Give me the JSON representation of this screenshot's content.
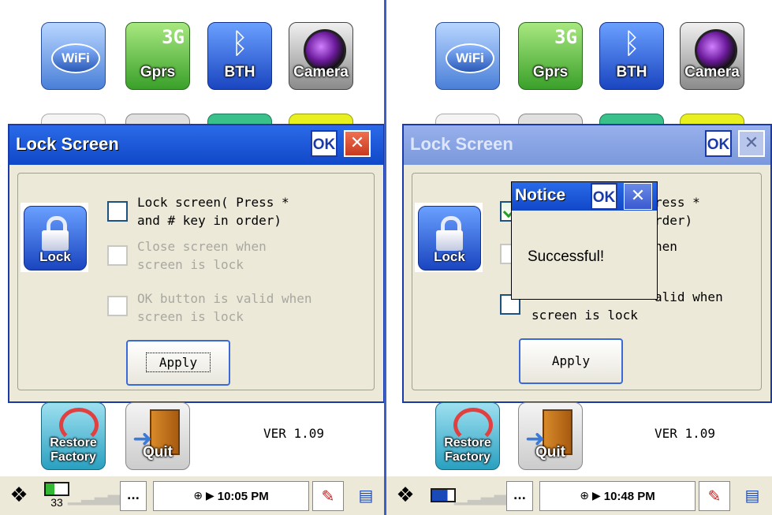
{
  "apps": {
    "wifi": "WiFi",
    "gprs": "Gprs",
    "gprs_badge": "3G",
    "bth": "BTH",
    "camera": "Camera",
    "restore": "Restore Factory",
    "quit": "Quit"
  },
  "lock_dialog": {
    "title": "Lock Screen",
    "ok": "OK",
    "close": "✕",
    "lock_label": "Lock",
    "options": [
      {
        "text": "Lock screen( Press *\nand # key in order)",
        "enabled": true
      },
      {
        "text": "Close screen when\nscreen is lock",
        "enabled": false
      },
      {
        "text": "OK button is valid when\nscreen is lock",
        "enabled": false
      }
    ],
    "apply": "Apply"
  },
  "right_lock_dialog": {
    "option1": "ress *\nrder)",
    "option2": "hen",
    "option3": "alid when",
    "option3b": "screen is lock",
    "checked": true
  },
  "notice": {
    "title": "Notice",
    "ok": "OK",
    "close": "✕",
    "message": "Successful!"
  },
  "version": "VER 1.09",
  "taskbar_left": {
    "battery_percent": "33",
    "keyboard": "...",
    "clock": "10:05 PM"
  },
  "taskbar_right": {
    "keyboard": "...",
    "clock": "10:48 PM"
  },
  "icons": {
    "start": "windows-flag-icon",
    "signal": "signal-bars-icon",
    "network": "network-icon",
    "pen": "pen-input-icon",
    "windows": "window-switcher-icon"
  },
  "colors": {
    "titlebar": "#1048c8",
    "titlebar_inactive": "#7a98dc",
    "dialog_bg": "#ece9d8",
    "close": "#c83a20",
    "check": "#21a121"
  }
}
